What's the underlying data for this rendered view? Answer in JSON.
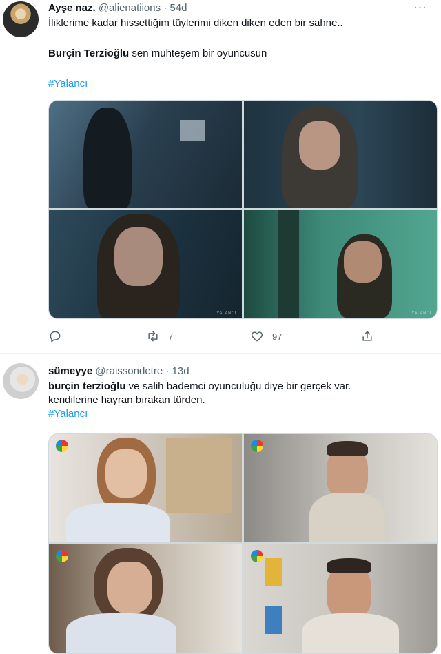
{
  "tweets": [
    {
      "name": "Ayşe naz.",
      "handle": "@alienatiions",
      "dot": "·",
      "time": "54d",
      "more_label": "···",
      "line1": "İliklerime kadar hissettiğim tüylerimi diken diken eden bir sahne..",
      "line2_bold": "Burçin Terzioğlu",
      "line2_rest": " sen muhteşem bir oyuncusun",
      "hashtag": "#Yalancı",
      "media_watermarks": [
        "YALANCI",
        "YALANCI"
      ],
      "actions": {
        "reply_count": "",
        "retweet_count": "7",
        "like_count": "97"
      }
    },
    {
      "name": "sümeyye",
      "handle": "@raissondetre",
      "dot": "·",
      "time": "13d",
      "line1_bold": "burçin terzioğlu",
      "line1_rest": " ve salih bademci oyunculuğu diye bir gerçek var.",
      "line2": "kendilerine hayran bırakan türden.",
      "hashtag": "#Yalancı"
    }
  ],
  "colors": {
    "link": "#1d9bf0",
    "muted": "#536471",
    "text": "#0f1419"
  },
  "icons": [
    "reply-icon",
    "retweet-icon",
    "like-icon",
    "share-icon",
    "more-icon",
    "channel-logo-icon"
  ]
}
